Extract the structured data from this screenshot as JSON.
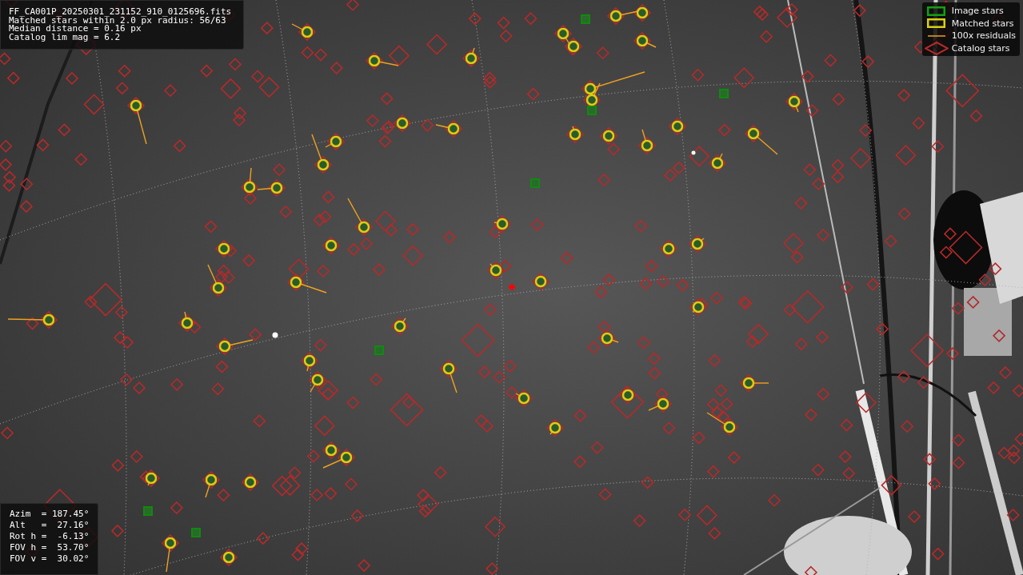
{
  "info": {
    "lines": [
      "FF_CA001P_20250301_231152_910_0125696.fits",
      "Matched stars within 2.0 px radius: 56/63",
      "Median distance = 0.16 px",
      "Catalog lim mag = 6.2"
    ]
  },
  "legend": [
    {
      "label": "Image stars"
    },
    {
      "kind": "matched",
      "label": "Matched stars"
    },
    {
      "kind": "residual",
      "label": "100x residuals"
    },
    {
      "kind": "catalog",
      "label": "Catalog stars"
    }
  ],
  "pointing": {
    "lines": [
      "Azim  = 187.45°",
      "Alt   =  27.16°",
      "Rot h =  -6.13°",
      "FOV h =  53.70°",
      "FOV v =  30.02°"
    ]
  }
}
